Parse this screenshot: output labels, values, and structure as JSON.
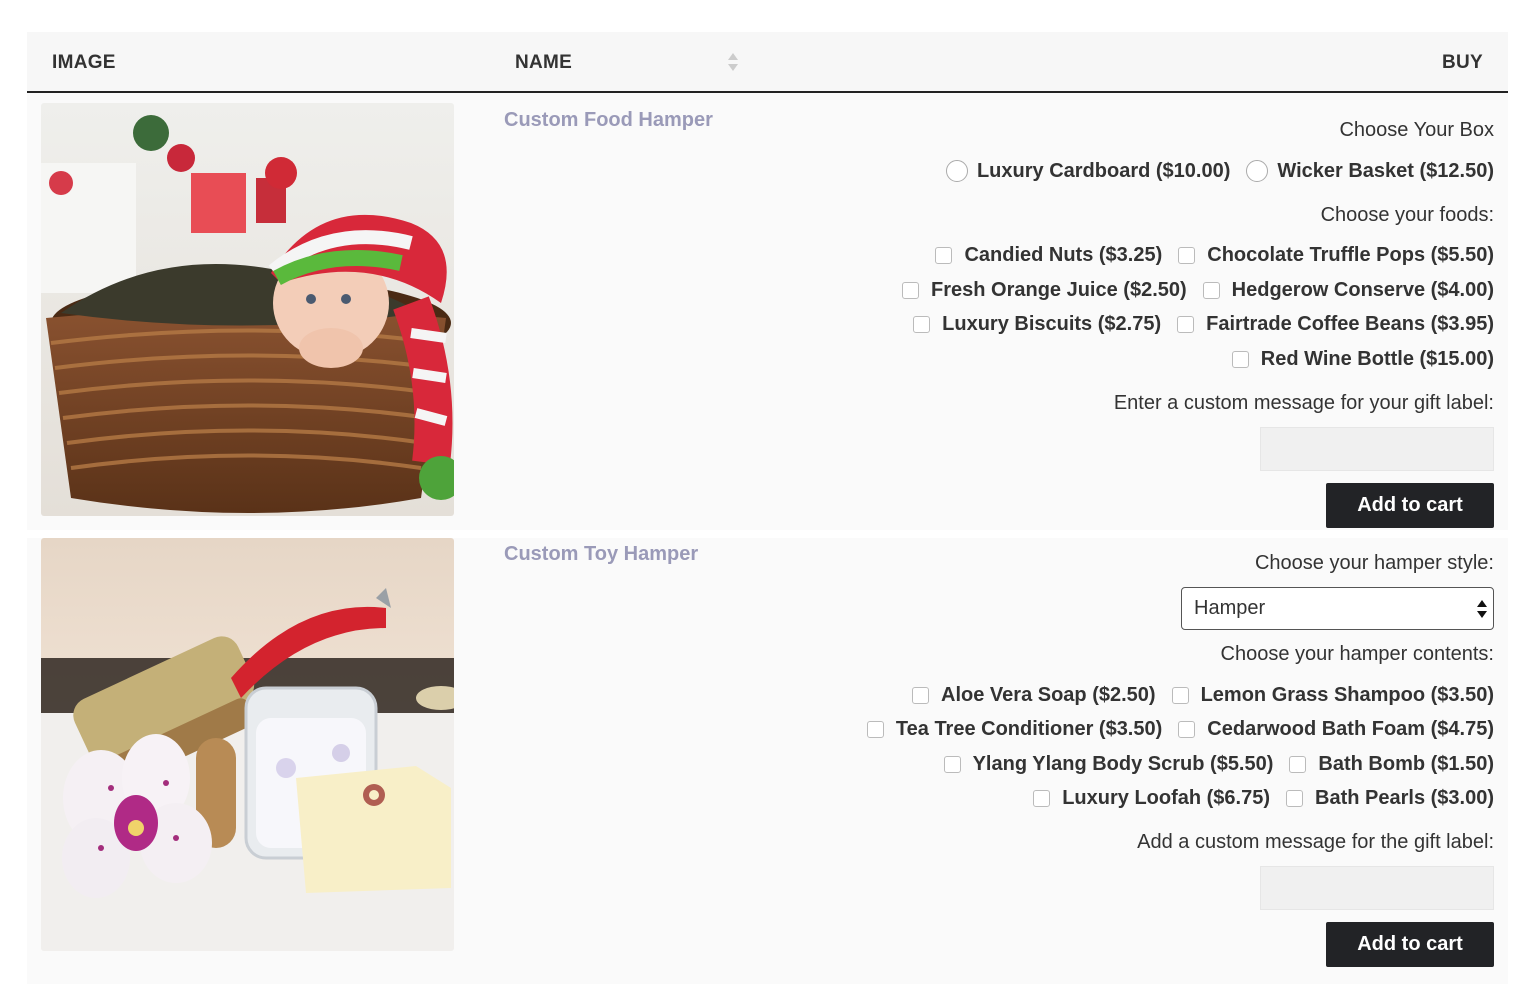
{
  "header": {
    "image_label": "IMAGE",
    "name_label": "NAME",
    "buy_label": "BUY"
  },
  "products": [
    {
      "name": "Custom Food Hamper",
      "box_label": "Choose Your Box",
      "box_options": [
        "Luxury Cardboard ($10.00)",
        "Wicker Basket ($12.50)"
      ],
      "foods_label": "Choose your foods:",
      "foods": [
        "Candied Nuts ($3.25)",
        "Chocolate Truffle Pops ($5.50)",
        "Fresh Orange Juice ($2.50)",
        "Hedgerow Conserve ($4.00)",
        "Luxury Biscuits ($2.75)",
        "Fairtrade Coffee Beans ($3.95)",
        "Red Wine Bottle ($15.00)"
      ],
      "message_label": "Enter a custom message for your gift label:",
      "message_value": "",
      "button": "Add to cart"
    },
    {
      "name": "Custom Toy Hamper",
      "style_label": "Choose your hamper style:",
      "style_selected": "Hamper",
      "contents_label": "Choose your hamper contents:",
      "contents": [
        "Aloe Vera Soap ($2.50)",
        "Lemon Grass Shampoo ($3.50)",
        "Tea Tree Conditioner ($3.50)",
        "Cedarwood Bath Foam ($4.75)",
        "Ylang Ylang Body Scrub ($5.50)",
        "Bath Bomb ($1.50)",
        "Luxury Loofah ($6.75)",
        "Bath Pearls ($3.00)"
      ],
      "message_label": "Add a custom message for the gift label:",
      "message_value": "",
      "button": "Add to cart"
    }
  ],
  "colors": {
    "product_link": "#9a9ab8",
    "button_bg": "#222326",
    "row_bg": "#fafafa",
    "header_bg": "#f7f7f7"
  }
}
